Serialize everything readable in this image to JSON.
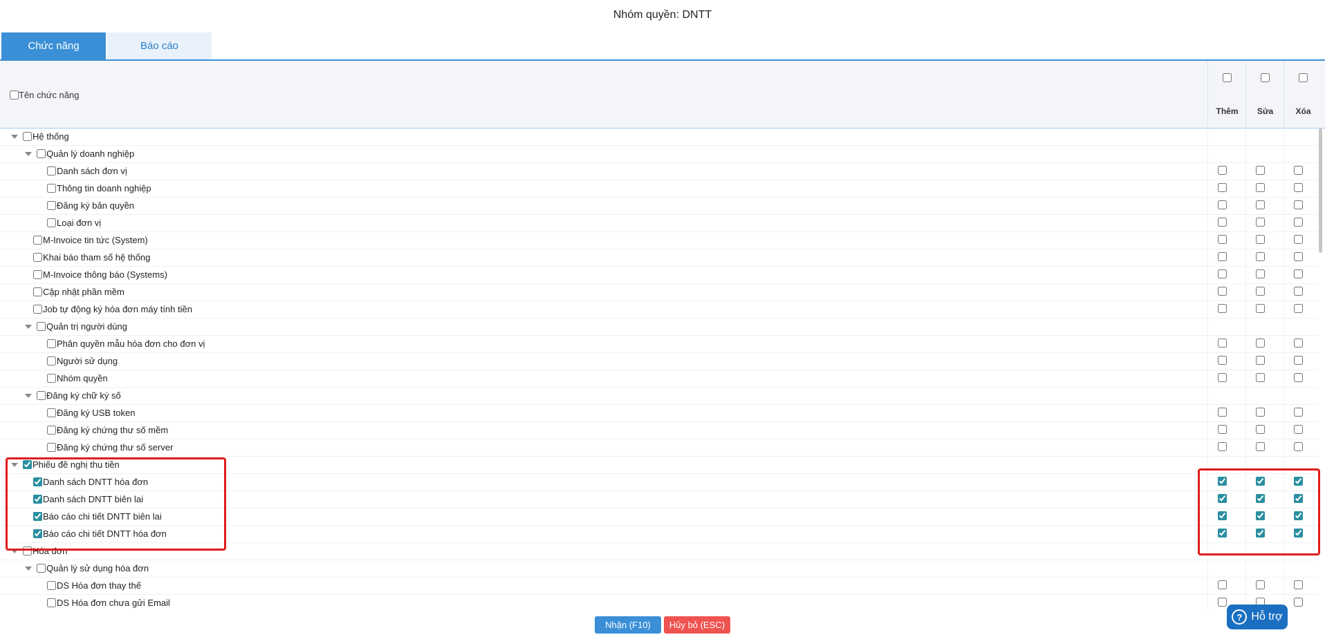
{
  "title": "Nhóm quyền: DNTT",
  "tabs": [
    {
      "label": "Chức năng",
      "active": true
    },
    {
      "label": "Báo cáo",
      "active": false
    }
  ],
  "header": {
    "name_label": "Tên chức năng",
    "columns": [
      "Thêm",
      "Sửa",
      "Xóa"
    ]
  },
  "rows": [
    {
      "label": "Hệ thống",
      "level": 0,
      "expandable": true,
      "checked": false,
      "perms": null
    },
    {
      "label": "Quản lý doanh nghiệp",
      "level": 1,
      "expandable": true,
      "checked": false,
      "perms": null
    },
    {
      "label": "Danh sách đơn vị",
      "level": 2,
      "expandable": false,
      "checked": false,
      "perms": [
        false,
        false,
        false
      ]
    },
    {
      "label": "Thông tin doanh nghiệp",
      "level": 2,
      "expandable": false,
      "checked": false,
      "perms": [
        false,
        false,
        false
      ]
    },
    {
      "label": "Đăng ký bản quyền",
      "level": 2,
      "expandable": false,
      "checked": false,
      "perms": [
        false,
        false,
        false
      ]
    },
    {
      "label": "Loại đơn vị",
      "level": 2,
      "expandable": false,
      "checked": false,
      "perms": [
        false,
        false,
        false
      ]
    },
    {
      "label": "M-Invoice tin tức (System)",
      "level": 1,
      "expandable": false,
      "checked": false,
      "perms": [
        false,
        false,
        false
      ]
    },
    {
      "label": "Khai báo tham số hệ thống",
      "level": 1,
      "expandable": false,
      "checked": false,
      "perms": [
        false,
        false,
        false
      ]
    },
    {
      "label": "M-Invoice thông báo (Systems)",
      "level": 1,
      "expandable": false,
      "checked": false,
      "perms": [
        false,
        false,
        false
      ]
    },
    {
      "label": "Cập nhật phần mềm",
      "level": 1,
      "expandable": false,
      "checked": false,
      "perms": [
        false,
        false,
        false
      ]
    },
    {
      "label": "Job tự động ký hóa đơn máy tính tiền",
      "level": 1,
      "expandable": false,
      "checked": false,
      "perms": [
        false,
        false,
        false
      ]
    },
    {
      "label": "Quản trị người dùng",
      "level": 1,
      "expandable": true,
      "checked": false,
      "perms": null
    },
    {
      "label": "Phân quyền mẫu hóa đơn cho đơn vị",
      "level": 2,
      "expandable": false,
      "checked": false,
      "perms": [
        false,
        false,
        false
      ]
    },
    {
      "label": "Người sử dụng",
      "level": 2,
      "expandable": false,
      "checked": false,
      "perms": [
        false,
        false,
        false
      ]
    },
    {
      "label": "Nhóm quyền",
      "level": 2,
      "expandable": false,
      "checked": false,
      "perms": [
        false,
        false,
        false
      ]
    },
    {
      "label": "Đăng ký chữ ký số",
      "level": 1,
      "expandable": true,
      "checked": false,
      "perms": null
    },
    {
      "label": "Đăng ký USB token",
      "level": 2,
      "expandable": false,
      "checked": false,
      "perms": [
        false,
        false,
        false
      ]
    },
    {
      "label": "Đăng ký chứng thư số mềm",
      "level": 2,
      "expandable": false,
      "checked": false,
      "perms": [
        false,
        false,
        false
      ]
    },
    {
      "label": "Đăng ký chứng thư số server",
      "level": 2,
      "expandable": false,
      "checked": false,
      "perms": [
        false,
        false,
        false
      ]
    },
    {
      "label": "Phiếu đề nghị thu tiền",
      "level": 0,
      "expandable": true,
      "checked": true,
      "perms": null
    },
    {
      "label": "Danh sách DNTT hóa đơn",
      "level": 1,
      "expandable": false,
      "checked": true,
      "perms": [
        true,
        true,
        true
      ]
    },
    {
      "label": "Danh sách DNTT biên lai",
      "level": 1,
      "expandable": false,
      "checked": true,
      "perms": [
        true,
        true,
        true
      ]
    },
    {
      "label": "Báo cáo chi tiết DNTT biên lai",
      "level": 1,
      "expandable": false,
      "checked": true,
      "perms": [
        true,
        true,
        true
      ]
    },
    {
      "label": "Báo cáo chi tiết DNTT hóa đơn",
      "level": 1,
      "expandable": false,
      "checked": true,
      "perms": [
        true,
        true,
        true
      ]
    },
    {
      "label": "Hóa đơn",
      "level": 0,
      "expandable": true,
      "checked": false,
      "perms": null
    },
    {
      "label": "Quản lý sử dụng hóa đơn",
      "level": 1,
      "expandable": true,
      "checked": false,
      "perms": null
    },
    {
      "label": "DS Hóa đơn thay thế",
      "level": 2,
      "expandable": false,
      "checked": false,
      "perms": [
        false,
        false,
        false
      ]
    },
    {
      "label": "DS Hóa đơn chưa gửi Email",
      "level": 2,
      "expandable": false,
      "checked": false,
      "perms": [
        false,
        false,
        false
      ]
    }
  ],
  "footer": {
    "ok_label": "Nhận (F10)",
    "cancel_label": "Hủy bỏ (ESC)"
  },
  "help": {
    "label": "Hỗ trợ"
  },
  "colors": {
    "accent": "#3a8fd6",
    "cancel": "#ef5350",
    "highlight": "#e01b1b",
    "checkbox": "#2a8fa0"
  }
}
